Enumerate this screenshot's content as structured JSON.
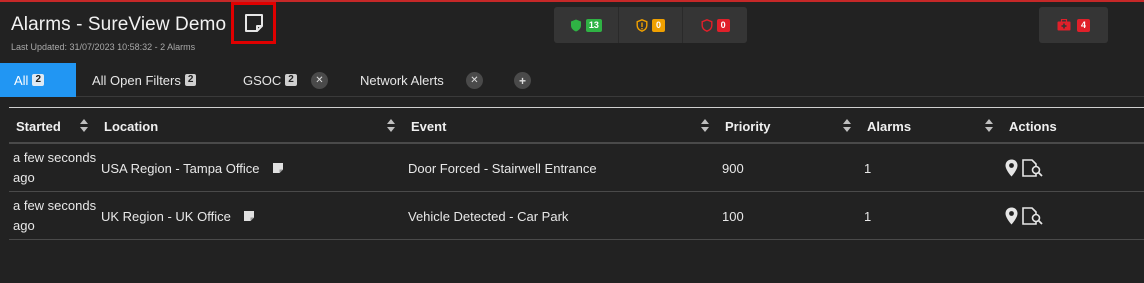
{
  "header": {
    "title": "Alarms - SureView Demo",
    "subtitle": "Last Updated: 31/07/2023 10:58:32 - 2 Alarms"
  },
  "status": {
    "secure_count": "13",
    "warning_count": "0",
    "danger_count": "0",
    "alert_count": "4"
  },
  "tabs": [
    {
      "label": "All",
      "count": "2"
    },
    {
      "label": "All Open Filters",
      "count": "2"
    },
    {
      "label": "GSOC",
      "count": "2"
    },
    {
      "label": "Network Alerts"
    }
  ],
  "columns": [
    "Started",
    "Location",
    "Event",
    "Priority",
    "Alarms",
    "Actions"
  ],
  "rows": [
    {
      "started": "a few seconds ago",
      "location": "USA Region - Tampa Office",
      "event": "Door Forced - Stairwell Entrance",
      "priority": "900",
      "alarms": "1"
    },
    {
      "started": "a few seconds ago",
      "location": "UK Region - UK Office",
      "event": "Vehicle Detected - Car Park",
      "priority": "100",
      "alarms": "1"
    }
  ],
  "colors": {
    "accent": "#2196f3",
    "secure": "#2fb344",
    "warning": "#f0a000",
    "danger": "#e0202a"
  }
}
